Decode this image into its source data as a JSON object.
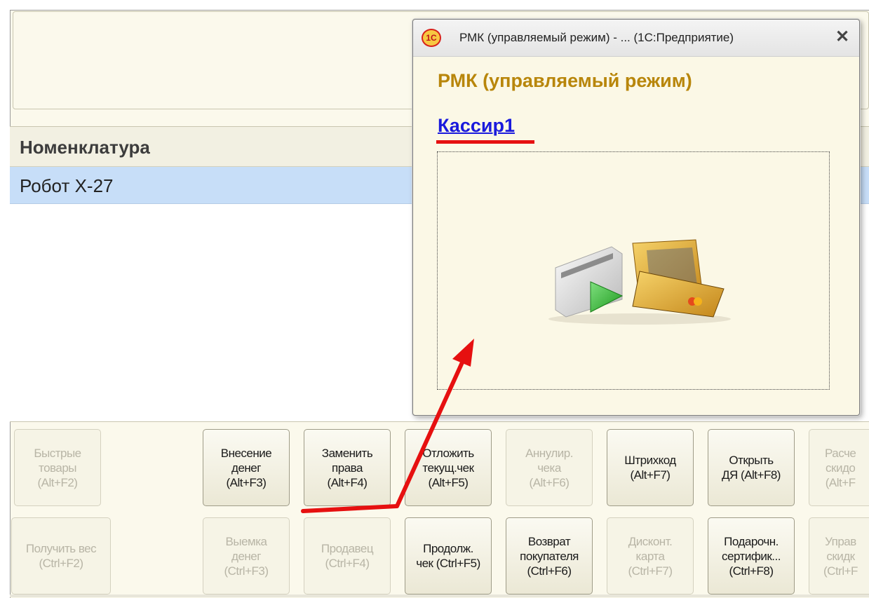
{
  "table": {
    "header": "Номенклатура",
    "rows": [
      {
        "name": "Робот Х-27"
      }
    ]
  },
  "buttons_row1": [
    {
      "label": "Быстрые\nтовары\n(Alt+F2)",
      "enabled": false
    },
    {
      "label": "Внесение\nденег\n(Alt+F3)",
      "enabled": true
    },
    {
      "label": "Заменить\nправа\n(Alt+F4)",
      "enabled": true
    },
    {
      "label": "Отложить\nтекущ.чек\n(Alt+F5)",
      "enabled": true
    },
    {
      "label": "Аннулир.\nчека\n(Alt+F6)",
      "enabled": false
    },
    {
      "label": "Штрихкод\n(Alt+F7)",
      "enabled": true
    },
    {
      "label": "Открыть\nДЯ (Alt+F8)",
      "enabled": true
    },
    {
      "label": "Расче\nскидо\n(Alt+F",
      "enabled": false
    }
  ],
  "buttons_row2": [
    {
      "label": "Получить вес\n(Ctrl+F2)",
      "enabled": false
    },
    {
      "label": "Выемка\nденег\n(Ctrl+F3)",
      "enabled": false
    },
    {
      "label": "Продавец\n(Ctrl+F4)",
      "enabled": false
    },
    {
      "label": "Продолж.\nчек (Ctrl+F5)",
      "enabled": true
    },
    {
      "label": "Возврат\nпокупателя\n(Ctrl+F6)",
      "enabled": true
    },
    {
      "label": "Дисконт.\nкарта\n(Ctrl+F7)",
      "enabled": false
    },
    {
      "label": "Подарочн.\nсертифик...\n(Ctrl+F8)",
      "enabled": true
    },
    {
      "label": "Управ\nскидк\n(Ctrl+F",
      "enabled": false
    }
  ],
  "dialog": {
    "logo": "1С",
    "title": "РМК (управляемый режим) - ...  (1С:Предприятие)",
    "close": "✕",
    "heading": "РМК (управляемый режим)",
    "user": "Кассир1",
    "image_icon": "card-reader-icon"
  },
  "colors": {
    "accent_gold": "#b8860b",
    "user_link": "#1a1adc",
    "annotation_red": "#e61010",
    "selected_row": "#c7def8",
    "panel_bg": "#fbf9ec"
  }
}
